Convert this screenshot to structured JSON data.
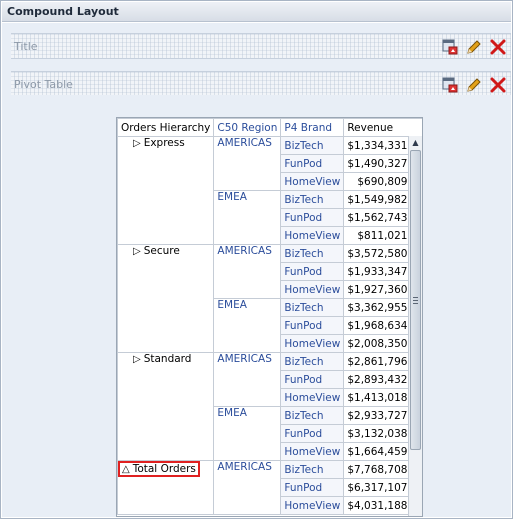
{
  "header": {
    "title": "Compound Layout"
  },
  "views": {
    "title_view": {
      "label": "Title"
    },
    "pivot_view": {
      "label": "Pivot Table"
    }
  },
  "icons": {
    "format": "format-view-icon",
    "edit": "edit-pencil-icon",
    "remove": "remove-x-icon"
  },
  "pivot": {
    "columns": [
      "Orders Hierarchy",
      "C50 Region",
      "P4 Brand",
      "Revenue"
    ],
    "groups": [
      {
        "hier": "Express",
        "regions": [
          {
            "name": "AMERICAS",
            "rows": [
              [
                "BizTech",
                "$1,334,331.37"
              ],
              [
                "FunPod",
                "$1,490,327.02"
              ],
              [
                "HomeView",
                "$690,809.01"
              ]
            ]
          },
          {
            "name": "EMEA",
            "rows": [
              [
                "BizTech",
                "$1,549,982.39"
              ],
              [
                "FunPod",
                "$1,562,743.31"
              ],
              [
                "HomeView",
                "$811,021.45"
              ]
            ]
          }
        ]
      },
      {
        "hier": "Secure",
        "regions": [
          {
            "name": "AMERICAS",
            "rows": [
              [
                "BizTech",
                "$3,572,580.86"
              ],
              [
                "FunPod",
                "$1,933,347.95"
              ],
              [
                "HomeView",
                "$1,927,360.42"
              ]
            ]
          },
          {
            "name": "EMEA",
            "rows": [
              [
                "BizTech",
                "$3,362,955.68"
              ],
              [
                "FunPod",
                "$1,968,634.87"
              ],
              [
                "HomeView",
                "$2,008,350.17"
              ]
            ]
          }
        ]
      },
      {
        "hier": "Standard",
        "regions": [
          {
            "name": "AMERICAS",
            "rows": [
              [
                "BizTech",
                "$2,861,796.44"
              ],
              [
                "FunPod",
                "$2,893,432.32"
              ],
              [
                "HomeView",
                "$1,413,018.86"
              ]
            ]
          },
          {
            "name": "EMEA",
            "rows": [
              [
                "BizTech",
                "$2,933,727.64"
              ],
              [
                "FunPod",
                "$3,132,038.63"
              ],
              [
                "HomeView",
                "$1,664,459.08"
              ]
            ]
          }
        ]
      },
      {
        "hier": "Total Orders",
        "total": true,
        "regions": [
          {
            "name": "AMERICAS",
            "rows": [
              [
                "BizTech",
                "$7,768,708.67"
              ],
              [
                "FunPod",
                "$6,317,107.29"
              ],
              [
                "HomeView",
                "$4,031,188.29"
              ]
            ]
          }
        ]
      }
    ]
  }
}
